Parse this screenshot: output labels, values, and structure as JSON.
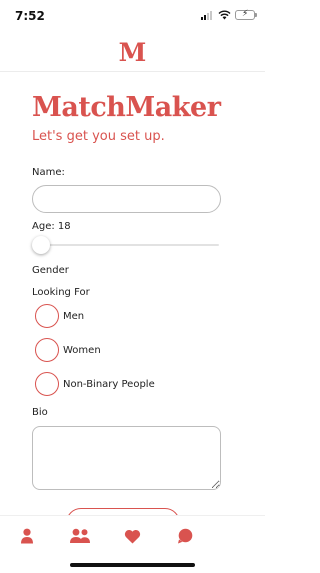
{
  "status_bar": {
    "time": "7:52",
    "battery_level": 0.45
  },
  "header": {
    "logo": "M"
  },
  "brand": {
    "title": "MatchMaker",
    "subtitle": "Let's get you set up."
  },
  "form": {
    "name_label": "Name:",
    "name_value": "",
    "age_label": "Age: 18",
    "age_value": 18,
    "gender_label": "Gender",
    "looking_for_label": "Looking For",
    "looking_for_options": [
      "Men",
      "Women",
      "Non-Binary People"
    ],
    "bio_label": "Bio",
    "bio_value": ""
  },
  "tab_bar": {
    "tabs": [
      "person-icon",
      "people-icon",
      "heart-icon",
      "chat-icon"
    ]
  },
  "colors": {
    "accent": "#d9534f",
    "border": "#bdbdbd"
  }
}
